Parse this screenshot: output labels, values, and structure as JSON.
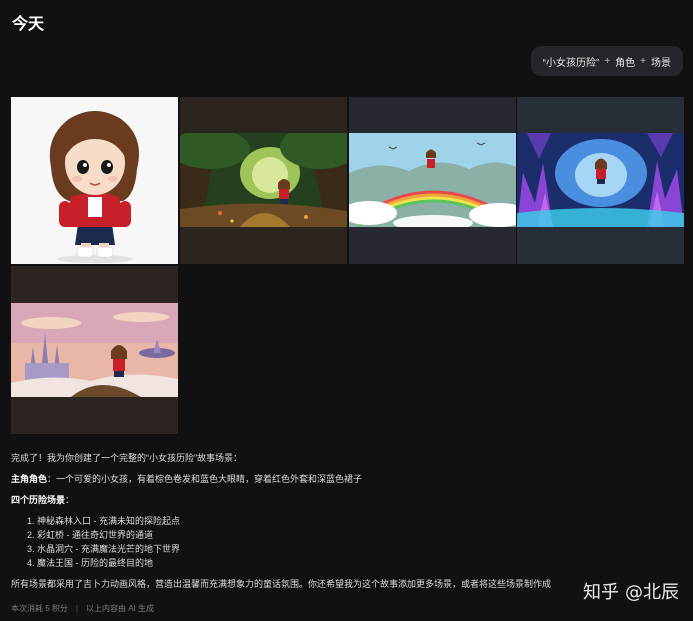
{
  "header": {
    "title": "今天"
  },
  "prompt": {
    "quote": "“小女孩历险”",
    "plus1": "+",
    "part2": "角色",
    "plus2": "+",
    "part3": "场景"
  },
  "gallery": {
    "items": [
      {
        "icon": "girl-character-illustration"
      },
      {
        "icon": "forest-entrance-illustration"
      },
      {
        "icon": "rainbow-bridge-illustration"
      },
      {
        "icon": "crystal-cave-illustration"
      },
      {
        "icon": "magic-kingdom-illustration"
      }
    ]
  },
  "message": {
    "intro": "完成了！我为你创建了一个完整的“小女孩历险”故事场景：",
    "role_label": "主角角色",
    "role_text": "：一个可爱的小女孩，有着棕色卷发和蓝色大眼睛，穿着红色外套和深蓝色裙子",
    "scenes_label": "四个历险场景",
    "scenes_colon": "：",
    "scenes": [
      "1. 神秘森林入口 - 充满未知的探险起点",
      "2. 彩虹桥 - 通往奇幻世界的通道",
      "3. 水晶洞穴 - 充满魔法光芒的地下世界",
      "4. 魔法王国 - 历险的最终目的地"
    ],
    "closing": "所有场景都采用了吉卜力动画风格，营造出温馨而充满想象力的童话氛围。你还希望我为这个故事添加更多场景，或者将这些场景制作成"
  },
  "footer": {
    "credits": "本次消耗 5 积分",
    "disclaimer": "以上内容由 AI 生成"
  },
  "watermark": {
    "site": "知乎",
    "handle": "@北辰"
  }
}
